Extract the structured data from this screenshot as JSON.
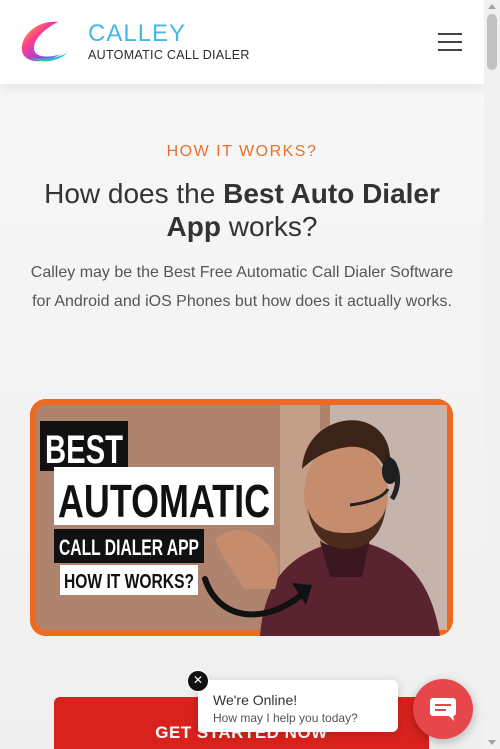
{
  "header": {
    "brand_name": "CALLEY",
    "brand_tagline": "AUTOMATIC CALL DIALER"
  },
  "section": {
    "eyebrow": "HOW IT WORKS?",
    "heading_pre": "How does the ",
    "heading_bold": "Best Auto Dialer App",
    "heading_post": " works?",
    "description": "Calley may be the Best Free Automatic Call Dialer Software for Android and iOS Phones but how does it actually works."
  },
  "video": {
    "line1": "BEST",
    "line2": "AUTOMATIC",
    "line3": "CALL DIALER APP",
    "line4": "HOW IT WORKS?"
  },
  "cta": {
    "label": "GET STARTED NOW"
  },
  "chat": {
    "title": "We're Online!",
    "subtitle": "How may I help you today?"
  },
  "colors": {
    "accent_orange": "#e9702b",
    "brand_blue": "#45b7e8",
    "cta_red": "#d9221d",
    "chat_red": "#e5474a"
  },
  "icons": [
    "hamburger-menu-icon",
    "close-icon",
    "chat-icon",
    "calley-logo-icon"
  ]
}
